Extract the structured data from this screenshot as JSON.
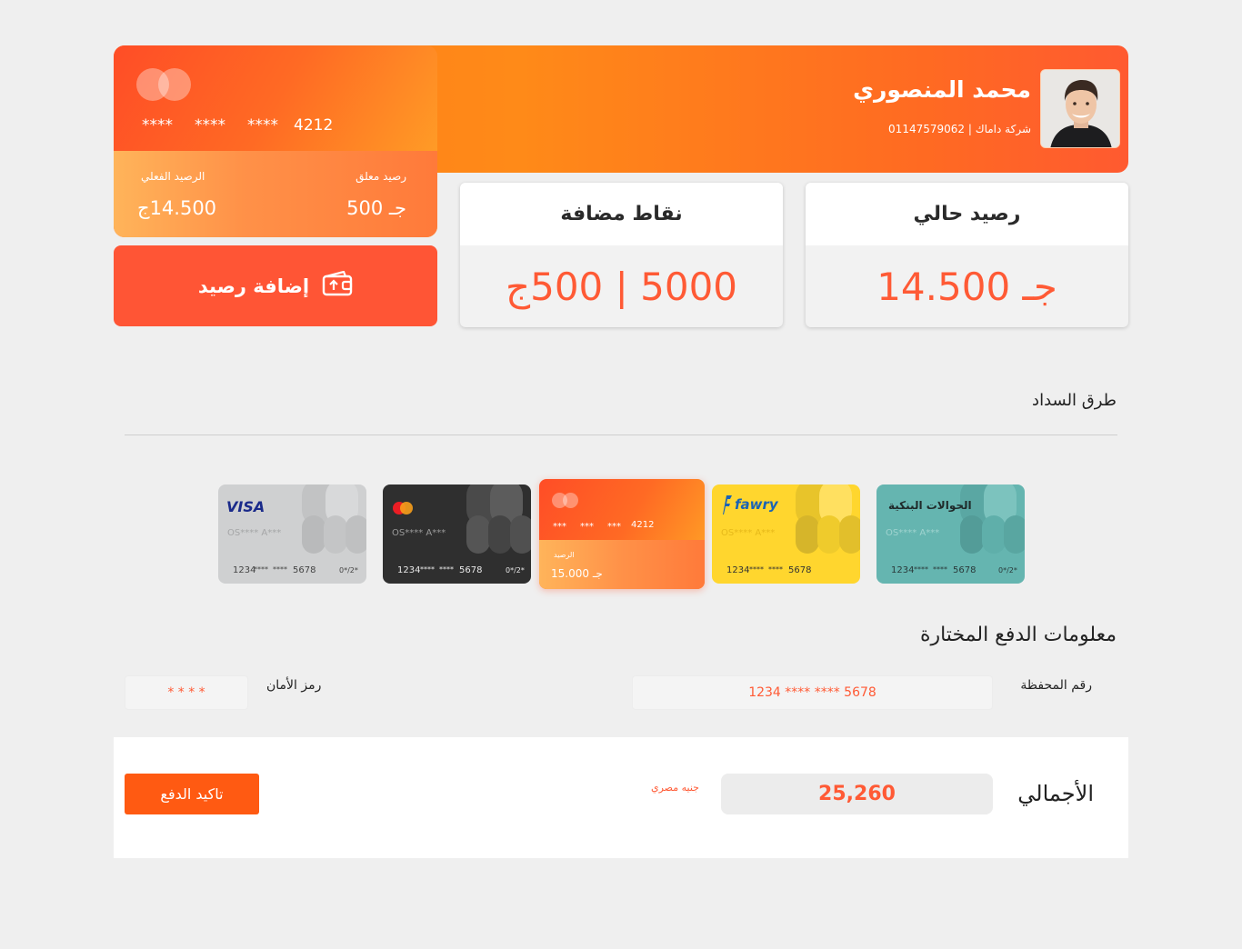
{
  "profile": {
    "name": "محمد المنصوري",
    "subtitle": "شركة داماك | 01147579062"
  },
  "wallet": {
    "masked_number": [
      "****",
      "****",
      "****",
      "4212"
    ],
    "pending_label": "رصيد معلق",
    "pending_value": "جـ 500",
    "actual_label": "الرصيد الفعلي",
    "actual_value": "14.500ج"
  },
  "add_balance": {
    "label": "إضافة رصيد",
    "icon": "wallet-add-icon"
  },
  "stats": {
    "current_balance": {
      "label": "رصيد حالي",
      "value": "جـ 14.500"
    },
    "points": {
      "label": "نقاط مضافة",
      "value": "5000 | 500ج"
    }
  },
  "payment_methods": {
    "title": "طرق السداد",
    "cards": [
      {
        "name": "visa",
        "brand": "VISA",
        "holder": "OS**** A***",
        "number": [
          "1234",
          "****",
          "****",
          "5678"
        ],
        "cvv": "0*/2*",
        "color": "#cfd0d1"
      },
      {
        "name": "mastercard",
        "brand": "mastercard",
        "holder": "OS**** A***",
        "number": [
          "1234",
          "****",
          "****",
          "5678"
        ],
        "cvv": "0*/2*",
        "color": "#2f2f2f"
      },
      {
        "name": "wallet",
        "number": [
          "***",
          "***",
          "***",
          "4212"
        ],
        "balance_label": "الرصيد",
        "balance_value": "جـ 15.000",
        "color": "#ff5a30"
      },
      {
        "name": "fawry",
        "brand": "fawry",
        "holder": "OS**** A***",
        "number": [
          "1234",
          "****",
          "****",
          "5678"
        ],
        "color": "#ffd62e"
      },
      {
        "name": "bank-transfer",
        "brand": "الحوالات البنكية",
        "holder": "OS**** A***",
        "number": [
          "1234",
          "****",
          "****",
          "5678"
        ],
        "cvv": "0*/2*",
        "color": "#65b5b0"
      }
    ]
  },
  "payment_info": {
    "title": "معلومات الدفع المختارة",
    "wallet_number_label": "رقم المحفظة",
    "wallet_number_value": "1234  ****  ****  5678",
    "security_code_label": "رمز الأمان",
    "security_code_value": "* * * *"
  },
  "total": {
    "label": "الأجمالي",
    "value": "25,260",
    "currency": "جنيه مصري",
    "confirm_label": "تاكيد الدفع"
  },
  "colors": {
    "accent": "#ff5a35",
    "orange": "#ff7a1a",
    "page_bg": "#efefef"
  }
}
